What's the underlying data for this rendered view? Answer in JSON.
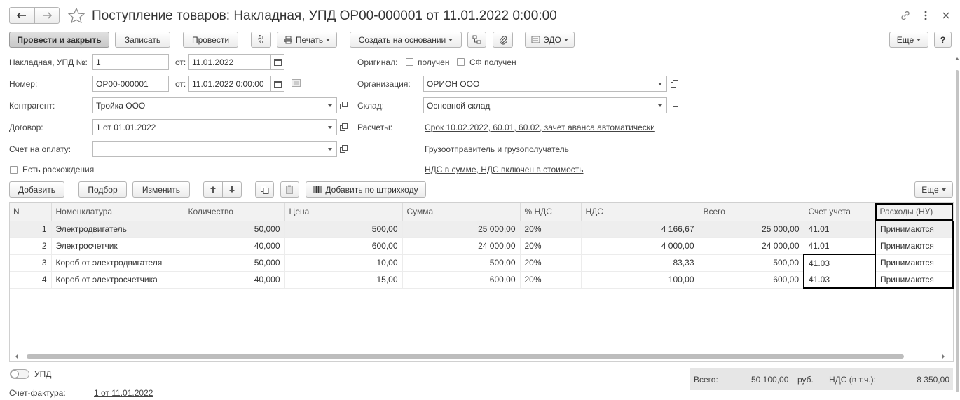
{
  "window": {
    "title": "Поступление товаров: Накладная, УПД ОР00-000001 от 11.01.2022 0:00:00"
  },
  "toolbar": {
    "post_close": "Провести и закрыть",
    "save": "Записать",
    "post": "Провести",
    "dt_kt": "Дт Кт",
    "print": "Печать",
    "create_based": "Создать на основании",
    "edo": "ЭДО",
    "more": "Еще",
    "help": "?"
  },
  "form": {
    "invoice_label": "Накладная, УПД №:",
    "invoice_value": "1",
    "from_label": "от:",
    "invoice_date": "11.01.2022",
    "number_label": "Номер:",
    "number_value": "ОР00-000001",
    "number_date": "11.01.2022  0:00:00",
    "contractor_label": "Контрагент:",
    "contractor_value": "Тройка ООО",
    "contract_label": "Договор:",
    "contract_value": "1 от 01.01.2022",
    "payment_label": "Счет на оплату:",
    "payment_value": "",
    "discrepancy_label": "Есть расхождения",
    "original_label": "Оригинал:",
    "received_label": "получен",
    "sf_received_label": "СФ получен",
    "org_label": "Организация:",
    "org_value": "ОРИОН ООО",
    "warehouse_label": "Склад:",
    "warehouse_value": "Основной склад",
    "settlements_label": "Расчеты:",
    "settlements_link": "Срок 10.02.2022, 60.01, 60.02, зачет аванса автоматически",
    "shipper_link": "Грузоотправитель и грузополучатель",
    "vat_link": "НДС в сумме, НДС включен в стоимость"
  },
  "table_toolbar": {
    "add": "Добавить",
    "select": "Подбор",
    "change": "Изменить",
    "barcode": "Добавить по штрихкоду",
    "more": "Еще"
  },
  "table": {
    "columns": [
      "N",
      "Номенклатура",
      "Количество",
      "Цена",
      "Сумма",
      "% НДС",
      "НДС",
      "Всего",
      "Счет учета",
      "Расходы (НУ)"
    ],
    "rows": [
      [
        "1",
        "Электродвигатель",
        "50,000",
        "500,00",
        "25 000,00",
        "20%",
        "4 166,67",
        "25 000,00",
        "41.01",
        "Принимаются"
      ],
      [
        "2",
        "Электросчетчик",
        "40,000",
        "600,00",
        "24 000,00",
        "20%",
        "4 000,00",
        "24 000,00",
        "41.01",
        "Принимаются"
      ],
      [
        "3",
        "Короб от электродвигателя",
        "50,000",
        "10,00",
        "500,00",
        "20%",
        "83,33",
        "500,00",
        "41.03",
        "Принимаются"
      ],
      [
        "4",
        "Короб от электросчетчика",
        "40,000",
        "15,00",
        "600,00",
        "20%",
        "100,00",
        "600,00",
        "41.03",
        "Принимаются"
      ]
    ]
  },
  "footer": {
    "upd_label": "УПД",
    "sf_label": "Счет-фактура:",
    "sf_link": "1 от 11.01.2022",
    "total_label": "Всего:",
    "total_value": "50 100,00",
    "currency": "руб.",
    "vat_label": "НДС (в т.ч.):",
    "vat_value": "8 350,00"
  }
}
